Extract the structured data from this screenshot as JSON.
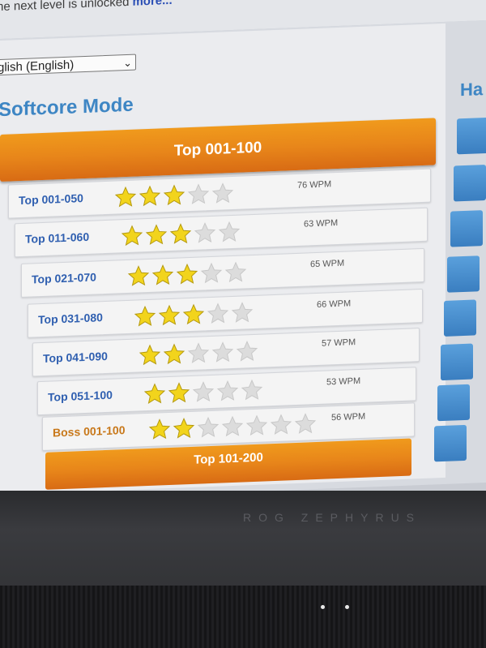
{
  "notice": {
    "text": "he next level is unlocked",
    "link": "more..."
  },
  "language": {
    "selected": "glish (English)"
  },
  "mode": {
    "title": "Softcore Mode",
    "other_title": "Ha"
  },
  "group": {
    "header": "Top 001-100",
    "next_header": "Top 101-200"
  },
  "levels": [
    {
      "label": "Top 001-050",
      "stars_filled": 3,
      "stars_total": 5,
      "wpm": "76 WPM"
    },
    {
      "label": "Top 011-060",
      "stars_filled": 3,
      "stars_total": 5,
      "wpm": "63 WPM"
    },
    {
      "label": "Top 021-070",
      "stars_filled": 3,
      "stars_total": 5,
      "wpm": "65 WPM"
    },
    {
      "label": "Top 031-080",
      "stars_filled": 3,
      "stars_total": 5,
      "wpm": "66 WPM"
    },
    {
      "label": "Top 041-090",
      "stars_filled": 2,
      "stars_total": 5,
      "wpm": "57 WPM"
    },
    {
      "label": "Top 051-100",
      "stars_filled": 2,
      "stars_total": 5,
      "wpm": "53 WPM"
    },
    {
      "label": "Boss 001-100",
      "stars_filled": 2,
      "stars_total": 7,
      "wpm": "56 WPM",
      "boss": true
    }
  ],
  "laptop": {
    "brand": "ROG ZEPHYRUS"
  },
  "colors": {
    "accent": "#3e86c4",
    "orange": "#e8861a",
    "star_filled": "#f2d41c",
    "star_empty": "#dcdcdc"
  }
}
